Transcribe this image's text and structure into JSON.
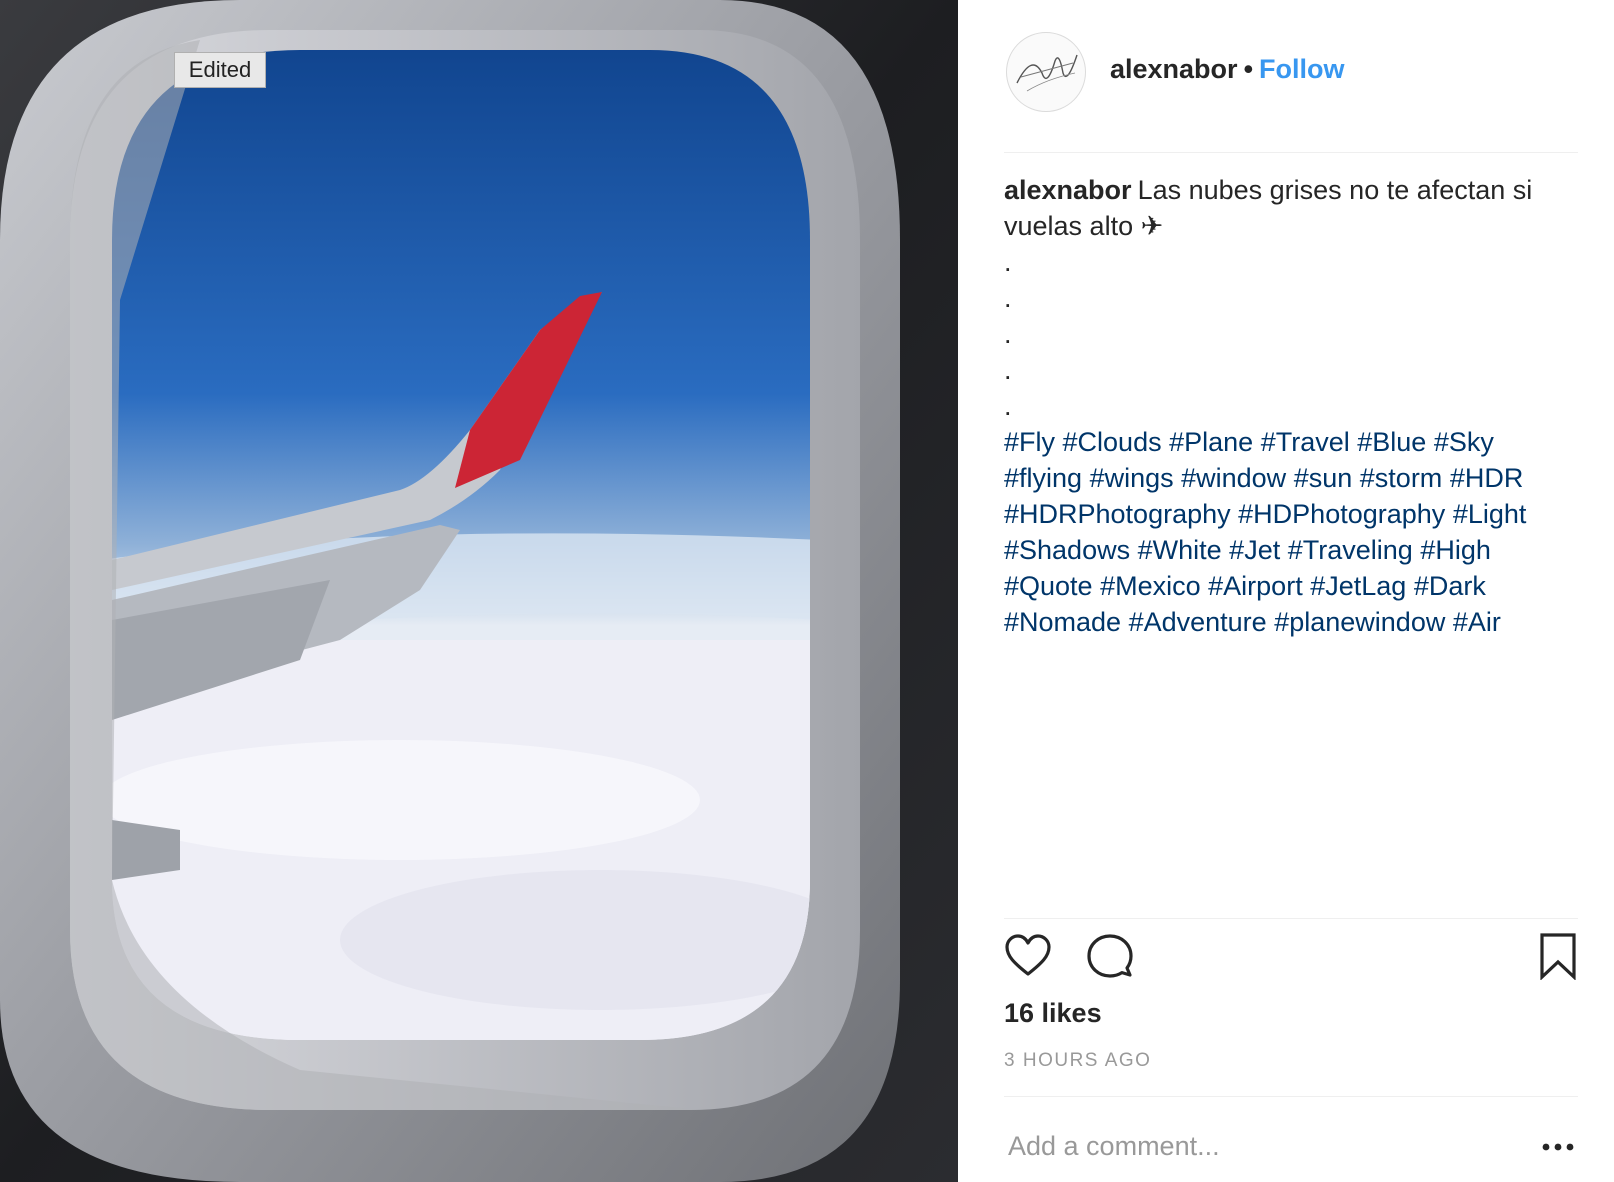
{
  "photo": {
    "badge_label": "Edited",
    "alt": "photo"
  },
  "header": {
    "username": "alexnabor",
    "separator": "•",
    "follow_label": "Follow"
  },
  "caption": {
    "username": "alexnabor",
    "text": "Las nubes grises no te afectan si vuelas alto ✈",
    "dot_lines": [
      ".",
      ".",
      ".",
      ".",
      "."
    ],
    "hashtags": [
      "#Fly",
      "#Clouds",
      "#Plane",
      "#Travel",
      "#Blue",
      "#Sky",
      "#flying",
      "#wings",
      "#window",
      "#sun",
      "#storm",
      "#HDR",
      "#HDRPhotography",
      "#HDPhotography",
      "#Light",
      "#Shadows",
      "#White",
      "#Jet",
      "#Traveling",
      "#High",
      "#Quote",
      "#Mexico",
      "#Airport",
      "#JetLag",
      "#Dark",
      "#Nomade",
      "#Adventure",
      "#planewindow",
      "#Air"
    ]
  },
  "actions": {
    "like_icon": "heart-icon",
    "comment_icon": "comment-bubble-icon",
    "save_icon": "bookmark-icon"
  },
  "likes_text": "16 likes",
  "timestamp": "3 HOURS AGO",
  "comment": {
    "placeholder": "Add a comment...",
    "value": "",
    "more_icon": "more-options-icon"
  },
  "colors": {
    "follow": "#3897f0",
    "hashtag": "#003569",
    "muted": "#999999",
    "divider": "#efefef"
  }
}
